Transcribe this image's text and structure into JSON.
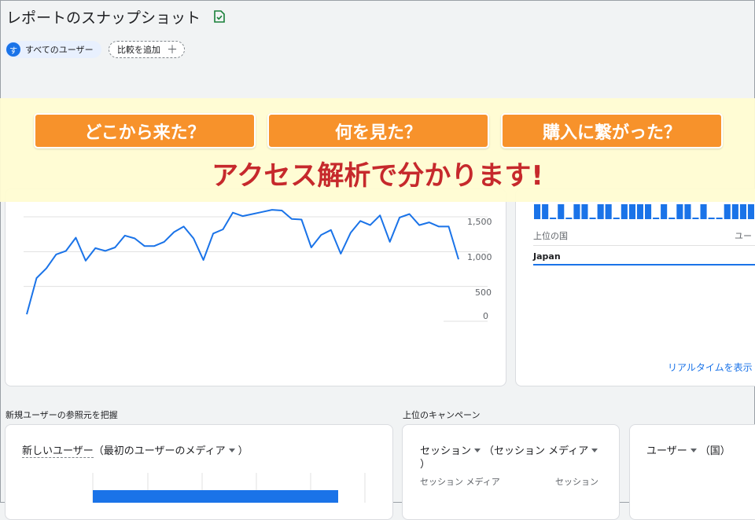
{
  "header": {
    "title": "レポートのスナップショット",
    "user_chip": {
      "avatar": "す",
      "label": "すべてのユーザー"
    },
    "compare_chip": {
      "label": "比較を追加",
      "icon": "plus-icon"
    }
  },
  "colors": {
    "accent": "#1a73e8",
    "banner_orange": "#f7922b",
    "headline_red": "#c6292c",
    "overlay": "#fffcd2"
  },
  "chart_data": {
    "type": "line",
    "yticks": [
      "1,500",
      "1,000",
      "500",
      "0"
    ],
    "ylim": [
      0,
      1700
    ],
    "values": [
      100,
      620,
      760,
      960,
      1010,
      1200,
      870,
      1050,
      1010,
      1060,
      1230,
      1190,
      1080,
      1080,
      1140,
      1280,
      1360,
      1190,
      880,
      1260,
      1320,
      1560,
      1510,
      1540,
      1570,
      1600,
      1590,
      1470,
      1460,
      1060,
      1240,
      1310,
      970,
      1270,
      1440,
      1380,
      1520,
      1140,
      1490,
      1540,
      1380,
      1420,
      1360,
      1360,
      890
    ]
  },
  "realtime": {
    "top_country_label": "上位の国",
    "users_label": "ユー",
    "country": "Japan",
    "bars": [
      1,
      1,
      0,
      1,
      0,
      1,
      1,
      0,
      1,
      1,
      0,
      1,
      1,
      1,
      1,
      0,
      1,
      0,
      1,
      1,
      0,
      1,
      0,
      0,
      1,
      1,
      1,
      1
    ],
    "link": "リアルタイムを表示"
  },
  "sections": {
    "new_users_title": "新規ユーザーの参照元を把握",
    "campaign_title": "上位のキャンペーン"
  },
  "new_users_card": {
    "metric": "新しいユーザー",
    "dimension": "（最初のユーザーのメディア",
    "close": "）"
  },
  "campaign_card": {
    "metric": "セッション",
    "dimension": "（セッション メディア",
    "close": "）",
    "col_dimension": "セッション メディア",
    "col_metric": "セッション"
  },
  "country_card": {
    "metric": "ユーザー",
    "dimension": "（国）"
  },
  "overlay": {
    "q1": "どこから来た？",
    "q2": "何を見た？",
    "q3": "購入に繋がった？",
    "headline": "アクセス解析で分かります!"
  }
}
